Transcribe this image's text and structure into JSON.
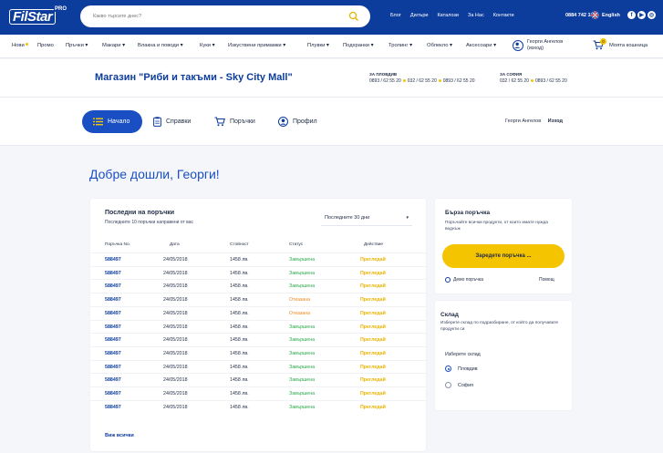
{
  "brand": {
    "logo_text": "FilStar",
    "logo_sup": "PRO"
  },
  "search": {
    "placeholder": "Какво търсите днес?"
  },
  "top_links": [
    "Блог",
    "Дилъри",
    "Каталози",
    "За Нас",
    "Контакти"
  ],
  "phone": "0884 742 185",
  "language": "English",
  "nav": [
    {
      "label": "Нови",
      "dot": true
    },
    {
      "label": "Промо",
      "dot": false
    },
    {
      "label": "Пръчки ▾",
      "dot": false
    },
    {
      "label": "Макари ▾",
      "dot": false
    },
    {
      "label": "Влакна и поводи ▾",
      "dot": false
    },
    {
      "label": "Куки ▾",
      "dot": false
    },
    {
      "label": "Изкуствени примамки ▾",
      "dot": false
    },
    {
      "label": "Плувки ▾",
      "dot": false
    },
    {
      "label": "Подхранки ▾",
      "dot": false
    },
    {
      "label": "Тролинг ▾",
      "dot": false
    },
    {
      "label": "Облекло ▾",
      "dot": false
    },
    {
      "label": "Аксесоари ▾",
      "dot": false
    }
  ],
  "user": {
    "name": "Георги Ангелов",
    "action": "(изход)"
  },
  "cart": {
    "label": "Моята кошница",
    "count": "0"
  },
  "store": {
    "title": "Магазин \"Риби и такъми - Sky City Mall\"",
    "cities": [
      {
        "name": "ЗА ПЛОВДИВ",
        "phones": [
          "0893 / 62 55 20",
          "032 / 62 55 20",
          "0893 / 62 55 20"
        ]
      },
      {
        "name": "ЗА СОФИЯ",
        "phones": [
          "032 / 62 55 20",
          "0893 / 62 55 20"
        ]
      }
    ]
  },
  "tabs": {
    "home": "Начало",
    "reports": "Справки",
    "orders": "Поръчки",
    "profile": "Профил"
  },
  "session": {
    "user": "Георги Ангелов",
    "logout": "Изход"
  },
  "welcome": "Добре дошли, Георги!",
  "orders": {
    "title": "Последни на поръчки",
    "subtitle": "Последните 10 поръчки направени от вас",
    "period": "Последните 30 дни",
    "columns": [
      "Поръчка No.",
      "Дата",
      "Стойност",
      "Статус",
      "Действие"
    ],
    "rows": [
      {
        "no": "588497",
        "date": "24/05/2018",
        "value": "1458 лв.",
        "status": "Завършена",
        "ok": true,
        "action": "Прегледай"
      },
      {
        "no": "588497",
        "date": "24/05/2018",
        "value": "1458 лв.",
        "status": "Завършена",
        "ok": true,
        "action": "Прегледай"
      },
      {
        "no": "588497",
        "date": "24/05/2018",
        "value": "1458 лв.",
        "status": "Завършена",
        "ok": true,
        "action": "Прегледай"
      },
      {
        "no": "588497",
        "date": "24/05/2018",
        "value": "1458 лв.",
        "status": "Отказана",
        "ok": false,
        "action": "Прегледай"
      },
      {
        "no": "588497",
        "date": "24/05/2018",
        "value": "1458 лв.",
        "status": "Отказана",
        "ok": false,
        "action": "Прегледай"
      },
      {
        "no": "588497",
        "date": "24/05/2018",
        "value": "1458 лв.",
        "status": "Завършена",
        "ok": true,
        "action": "Прегледай"
      },
      {
        "no": "588497",
        "date": "24/05/2018",
        "value": "1458 лв.",
        "status": "Завършена",
        "ok": true,
        "action": "Прегледай"
      },
      {
        "no": "588497",
        "date": "24/05/2018",
        "value": "1458 лв.",
        "status": "Завършена",
        "ok": true,
        "action": "Прегледай"
      },
      {
        "no": "588497",
        "date": "24/05/2018",
        "value": "1458 лв.",
        "status": "Завършена",
        "ok": true,
        "action": "Прегледай"
      },
      {
        "no": "588497",
        "date": "24/05/2018",
        "value": "1458 лв.",
        "status": "Завършена",
        "ok": true,
        "action": "Прегледай"
      },
      {
        "no": "588497",
        "date": "24/05/2018",
        "value": "1458 лв.",
        "status": "Завършена",
        "ok": true,
        "action": "Прегледай"
      },
      {
        "no": "588497",
        "date": "24/05/2018",
        "value": "1458 лв.",
        "status": "Завършена",
        "ok": true,
        "action": "Прегледай"
      }
    ],
    "see_all": "Виж всички"
  },
  "quick_order": {
    "title": "Бърза поръчка",
    "desc": "Поръчайте всички продукти, от които имате нужда веднъж",
    "button": "Заредете поръчка ...",
    "demo": "Демо поръчка",
    "help": "Помощ"
  },
  "warehouse": {
    "title": "Склад",
    "desc": "Изберете склад по подразбиране, от който да получавате продукти си",
    "label": "Изберете склад",
    "options": [
      {
        "label": "Пловдив",
        "selected": true
      },
      {
        "label": "София",
        "selected": false
      }
    ]
  },
  "colors": {
    "primary": "#0d3d9c",
    "accent": "#1a4fc4",
    "yellow": "#f5c400",
    "ok": "#2aa84a",
    "rejected": "#f08a24"
  }
}
